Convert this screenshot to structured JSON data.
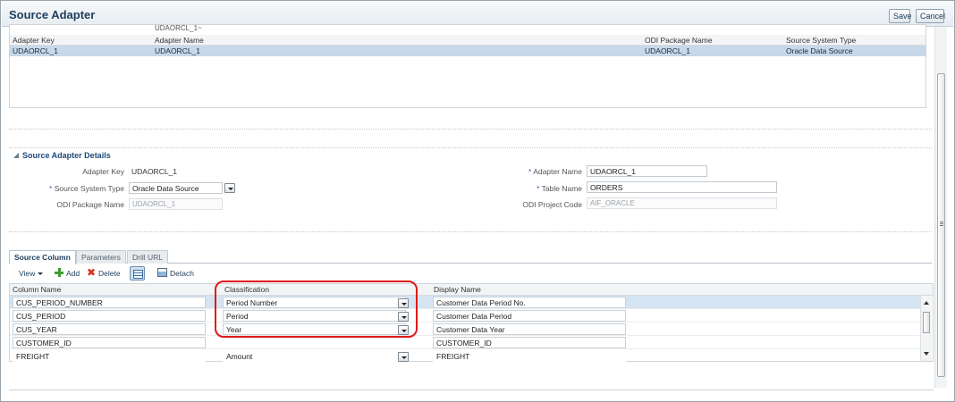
{
  "header": {
    "title": "Source Adapter",
    "save_label": "Save",
    "cancel_label": "Cancel"
  },
  "adapters_table": {
    "partial_row_text": "UDAORCL_1~",
    "columns": [
      "Adapter Key",
      "Adapter Name",
      "ODI Package Name",
      "Source System Type"
    ],
    "rows": [
      [
        "UDAORCL_1",
        "UDAORCL_1",
        "UDAORCL_1",
        "Oracle Data Source"
      ]
    ]
  },
  "details": {
    "title": "Source Adapter Details",
    "adapter_key_label": "Adapter Key",
    "adapter_key_value": "UDAORCL_1",
    "source_system_type_label": "Source System Type",
    "source_system_type_value": "Oracle Data Source",
    "odi_package_name_label": "ODI Package Name",
    "odi_package_name_value": "UDAORCL_1",
    "adapter_name_label": "Adapter Name",
    "adapter_name_value": "UDAORCL_1",
    "table_name_label": "Table Name",
    "table_name_value": "ORDERS",
    "odi_project_code_label": "ODI Project Code",
    "odi_project_code_value": "AIF_ORACLE",
    "required_mark": "*"
  },
  "tabs": [
    {
      "label": "Source Column",
      "active": true
    },
    {
      "label": "Parameters",
      "active": false
    },
    {
      "label": "Drill URL",
      "active": false
    }
  ],
  "toolbar": {
    "view_label": "View",
    "add_label": "Add",
    "delete_label": "Delete",
    "detach_label": "Detach"
  },
  "columns_grid": {
    "headers": [
      "Column Name",
      "Classification",
      "Display Name"
    ],
    "rows": [
      {
        "column_name": "CUS_PERIOD_NUMBER",
        "classification": "Period Number",
        "display_name": "Customer Data Period No.",
        "selected": true
      },
      {
        "column_name": "CUS_PERIOD",
        "classification": "Period",
        "display_name": "Customer Data Period",
        "selected": false
      },
      {
        "column_name": "CUS_YEAR",
        "classification": "Year",
        "display_name": "Customer Data Year",
        "selected": false
      },
      {
        "column_name": "CUSTOMER_ID",
        "classification": "",
        "display_name": "CUSTOMER_ID",
        "selected": false
      },
      {
        "column_name": "FREIGHT",
        "classification": "Amount",
        "display_name": "FREIGHT",
        "selected": false
      }
    ]
  },
  "colors": {
    "selected_row": "#c6d8ea",
    "highlight": "#e01919",
    "title": "#1d3d5c"
  }
}
